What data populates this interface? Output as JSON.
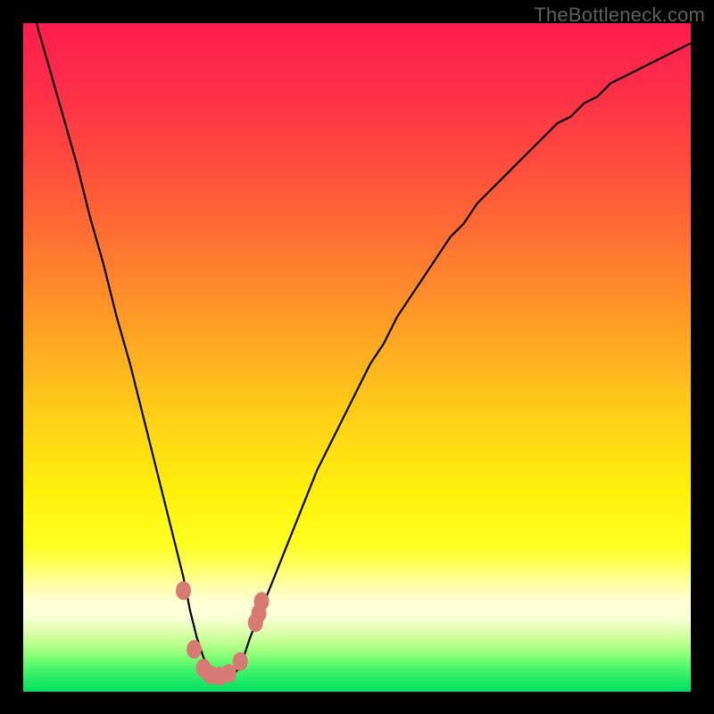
{
  "watermark": "TheBottleneck.com",
  "colors": {
    "frame": "#000000",
    "marker": "#d77a74",
    "curve": "#000000"
  },
  "chart_data": {
    "type": "line",
    "title": "",
    "xlabel": "",
    "ylabel": "",
    "xlim": [
      0,
      100
    ],
    "ylim": [
      0,
      100
    ],
    "grid": false,
    "legend": false,
    "series": [
      {
        "name": "bottleneck-curve",
        "x": [
          0,
          2,
          4,
          6,
          8,
          10,
          12,
          14,
          16,
          18,
          20,
          22,
          24,
          25,
          26,
          27,
          28,
          29,
          30,
          31,
          32,
          33,
          34,
          36,
          38,
          40,
          42,
          44,
          46,
          48,
          50,
          52,
          54,
          56,
          58,
          60,
          62,
          64,
          66,
          68,
          70,
          72,
          74,
          76,
          78,
          80,
          82,
          84,
          86,
          88,
          90,
          92,
          94,
          96,
          98,
          100
        ],
        "y": [
          106,
          100,
          93,
          86,
          79,
          71,
          64,
          56,
          49,
          41,
          33,
          25,
          17,
          12,
          8,
          5,
          3,
          2,
          2,
          2,
          3,
          5,
          8,
          13,
          18,
          23,
          28,
          33,
          37,
          41,
          45,
          49,
          52,
          56,
          59,
          62,
          65,
          68,
          70,
          73,
          75,
          77,
          79,
          81,
          83,
          85,
          86,
          88,
          89,
          91,
          92,
          93,
          94,
          95,
          96,
          97
        ]
      }
    ],
    "markers": [
      {
        "x": 24.0,
        "y": 15.0
      },
      {
        "x": 25.6,
        "y": 6.2
      },
      {
        "x": 27.0,
        "y": 3.4
      },
      {
        "x": 28.0,
        "y": 2.4
      },
      {
        "x": 29.4,
        "y": 2.2
      },
      {
        "x": 30.8,
        "y": 2.6
      },
      {
        "x": 32.5,
        "y": 4.4
      },
      {
        "x": 34.8,
        "y": 10.2
      },
      {
        "x": 35.3,
        "y": 11.6
      },
      {
        "x": 35.7,
        "y": 13.4
      }
    ],
    "gradient_stops": [
      {
        "pos": 0.0,
        "color": "#ff1d4e"
      },
      {
        "pos": 0.1,
        "color": "#ff2f48"
      },
      {
        "pos": 0.2,
        "color": "#ff4a3e"
      },
      {
        "pos": 0.3,
        "color": "#ff6a34"
      },
      {
        "pos": 0.4,
        "color": "#ff8c2a"
      },
      {
        "pos": 0.5,
        "color": "#ffb020"
      },
      {
        "pos": 0.6,
        "color": "#ffd416"
      },
      {
        "pos": 0.7,
        "color": "#fff00c"
      },
      {
        "pos": 0.78,
        "color": "#ffff20"
      },
      {
        "pos": 0.815,
        "color": "#ffff66"
      },
      {
        "pos": 0.845,
        "color": "#ffffb0"
      },
      {
        "pos": 0.87,
        "color": "#feffd8"
      },
      {
        "pos": 0.892,
        "color": "#f6ffd0"
      },
      {
        "pos": 0.91,
        "color": "#e0ffb0"
      },
      {
        "pos": 0.927,
        "color": "#c0ff90"
      },
      {
        "pos": 0.945,
        "color": "#90ff78"
      },
      {
        "pos": 0.965,
        "color": "#4CF56A"
      },
      {
        "pos": 1.0,
        "color": "#00E060"
      }
    ]
  }
}
